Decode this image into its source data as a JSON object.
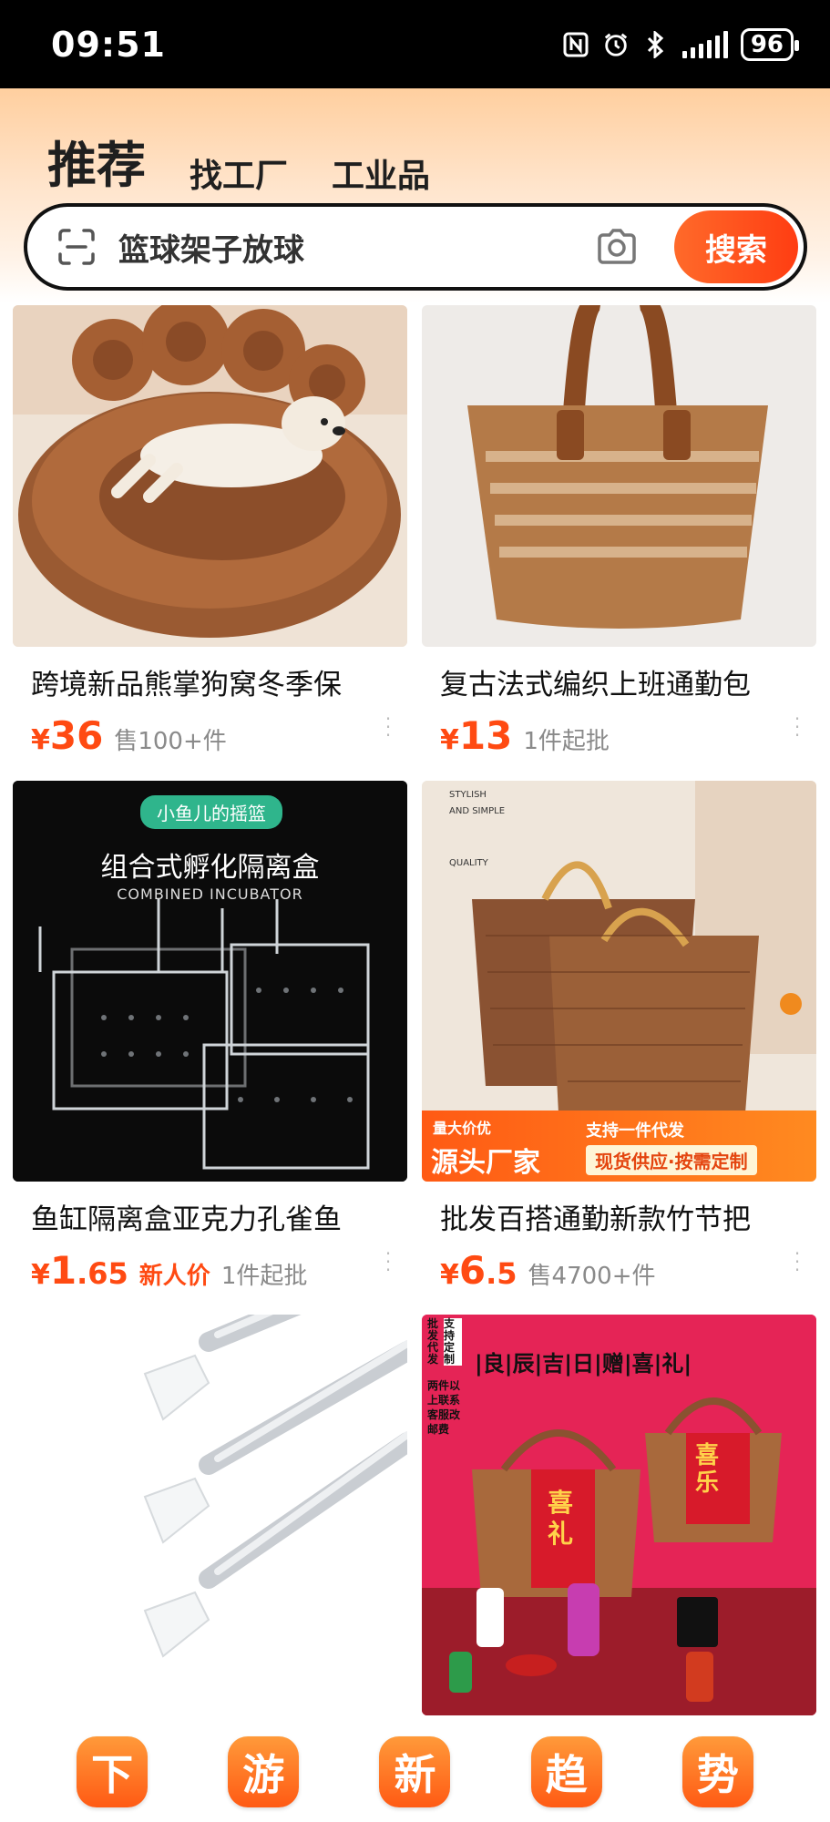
{
  "status_bar": {
    "time": "09:51",
    "battery": "96"
  },
  "tabs": [
    {
      "label": "推荐",
      "active": true
    },
    {
      "label": "找工厂",
      "active": false
    },
    {
      "label": "工业品",
      "active": false
    }
  ],
  "search": {
    "query": "篮球架子放球",
    "button_label": "搜索"
  },
  "products": [
    {
      "title": "跨境新品熊掌狗窝冬季保",
      "price_int": "36",
      "price_dec": "",
      "tag": "",
      "sales": "售100+件",
      "image": "dog-bed-image"
    },
    {
      "title": "复古法式编织上班通勤包",
      "price_int": "13",
      "price_dec": "",
      "tag": "",
      "sales": "1件起批",
      "image": "straw-bag-image"
    },
    {
      "title": "鱼缸隔离盒亚克力孔雀鱼",
      "price_int": "1",
      "price_dec": ".65",
      "tag": "新人价",
      "sales": "1件起批",
      "image": "incubator-image"
    },
    {
      "title": "批发百搭通勤新款竹节把",
      "price_int": "6",
      "price_dec": ".5",
      "tag": "",
      "sales": "售4700+件",
      "image": "bamboo-basket-image"
    },
    {
      "title": "",
      "price_int": "",
      "price_dec": "",
      "tag": "",
      "sales": "",
      "image": "telescopic-rod-image"
    },
    {
      "title": "",
      "price_int": "",
      "price_dec": "",
      "tag": "",
      "sales": "",
      "image": "gift-basket-image"
    }
  ],
  "overlays": {
    "incubator_badge": "小鱼儿的摇篮",
    "incubator_title": "组合式孵化隔离盒",
    "incubator_subtitle": "COMBINED INCUBATOR",
    "basket_text1": "STYLISH",
    "basket_text2": "AND SIMPLE",
    "basket_text3": "QUALITY",
    "basket_banner_small": "量大价优",
    "basket_banner_big": "源头厂家",
    "basket_banner_r1": "支持一件代发",
    "basket_banner_r2": "现货供应·按需定制",
    "gift_header": "|良|辰|吉|日|赠|喜|礼|",
    "gift_side1": "批发代发",
    "gift_side2": "支持定制",
    "gift_side3": "两件以上联系客服改邮费",
    "gift_char1": "喜礼",
    "gift_char2": "喜乐"
  },
  "bottom_bar": [
    "下",
    "游",
    "新",
    "趋",
    "势"
  ],
  "currency": "¥",
  "colors": {
    "accent": "#ff4a12",
    "status_bar": "#000000"
  }
}
